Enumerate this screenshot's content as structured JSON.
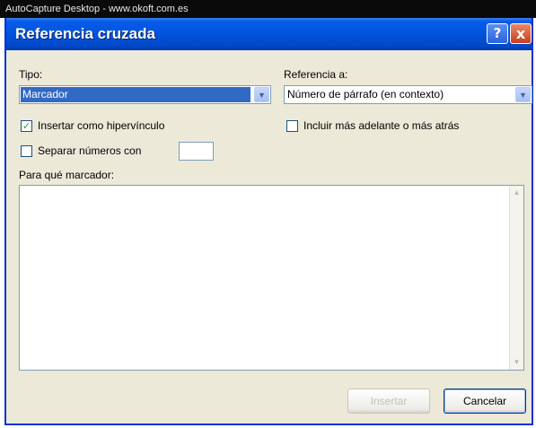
{
  "outer_window": {
    "title": "AutoCapture Desktop - www.okoft.com.es"
  },
  "dialog": {
    "title": "Referencia cruzada",
    "help_label": "?",
    "close_label": "x",
    "tipo": {
      "label": "Tipo:",
      "value": "Marcador"
    },
    "referencia": {
      "label": "Referencia a:",
      "value": "Número de párrafo (en contexto)"
    },
    "checkboxes": {
      "insertar_hipervinculo": {
        "label": "Insertar como hipervínculo",
        "checked": true
      },
      "incluir_adelante_atras": {
        "label": "Incluir más adelante o más atrás",
        "checked": false
      },
      "separar_numeros": {
        "label": "Separar números con",
        "checked": false,
        "value": ""
      }
    },
    "list": {
      "label": "Para qué marcador:",
      "items": []
    },
    "buttons": {
      "insertar": "Insertar",
      "cancelar": "Cancelar"
    }
  },
  "icons": {
    "dropdown": "chevron-down-icon",
    "check": "checkmark-icon",
    "help": "help-icon",
    "close": "close-icon"
  },
  "colors": {
    "titlebar": "#0256e0",
    "selection": "#316ac5",
    "dialog_bg": "#ece9d8",
    "close_button": "#c4401e"
  }
}
